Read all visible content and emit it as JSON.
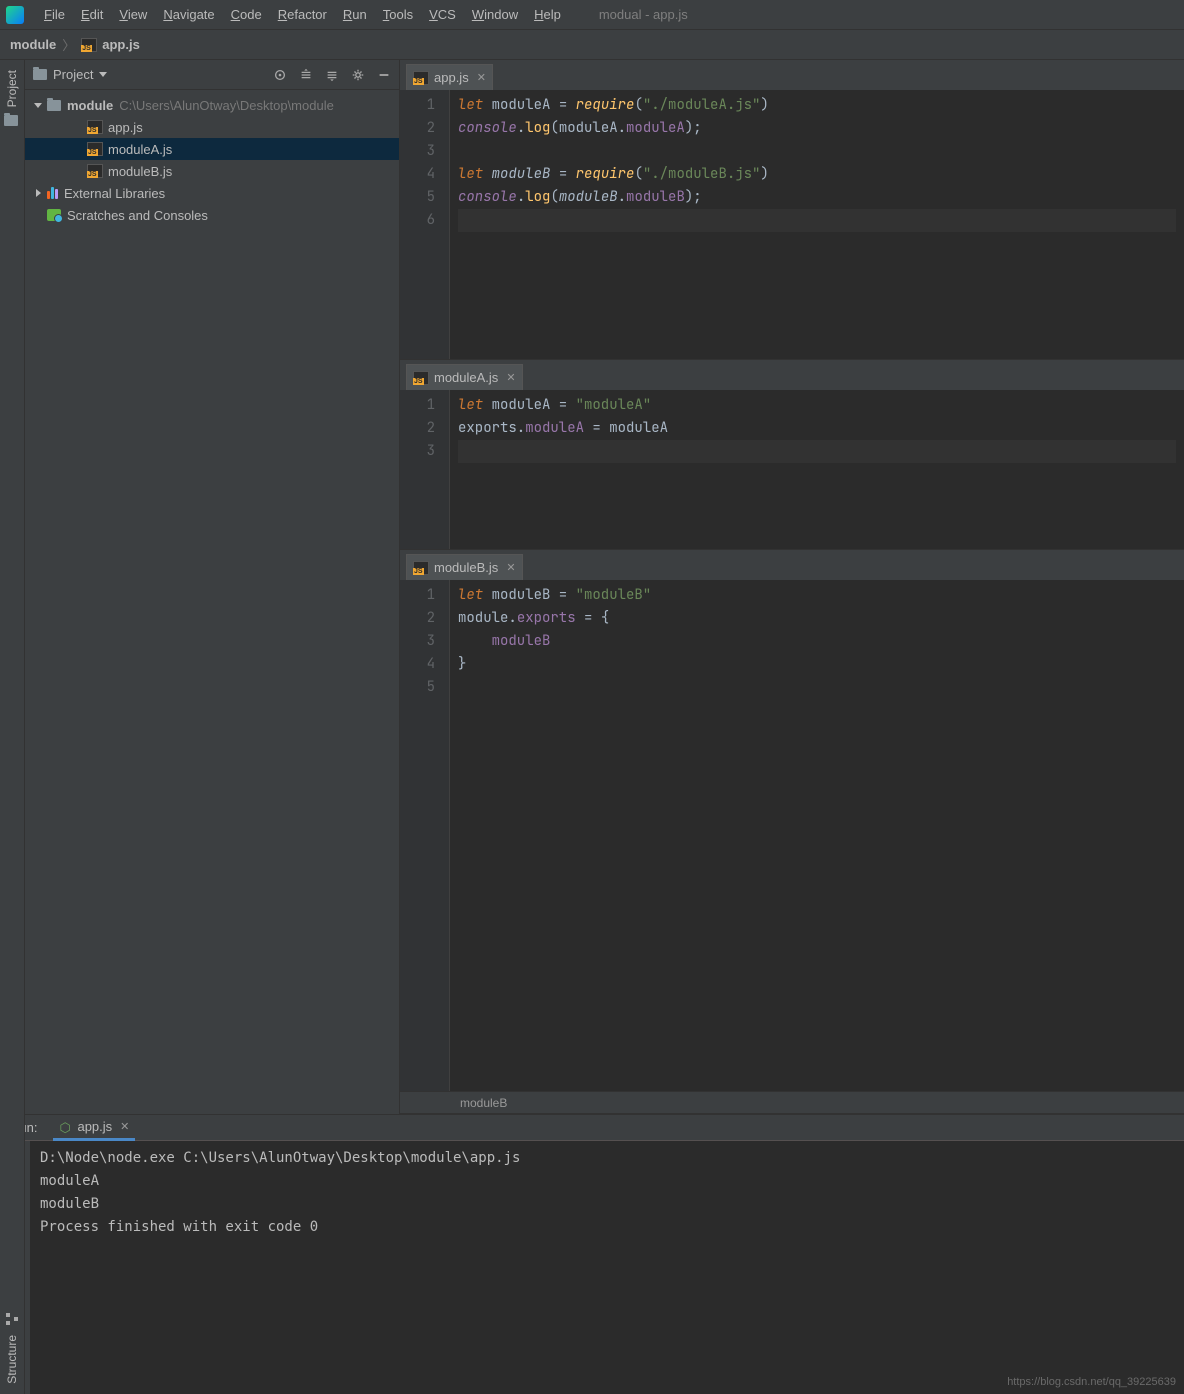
{
  "window_title": "modual - app.js",
  "menu": [
    "File",
    "Edit",
    "View",
    "Navigate",
    "Code",
    "Refactor",
    "Run",
    "Tools",
    "VCS",
    "Window",
    "Help"
  ],
  "breadcrumb": {
    "root": "module",
    "file": "app.js"
  },
  "project_pane": {
    "title": "Project",
    "items": [
      {
        "type": "folder",
        "label": "module",
        "path": "C:\\Users\\AlunOtway\\Desktop\\module",
        "expanded": true,
        "depth": 0,
        "bold": true
      },
      {
        "type": "js",
        "label": "app.js",
        "depth": 2
      },
      {
        "type": "js",
        "label": "moduleA.js",
        "depth": 2,
        "selected": true
      },
      {
        "type": "js",
        "label": "moduleB.js",
        "depth": 2
      },
      {
        "type": "lib",
        "label": "External Libraries",
        "depth": 0,
        "expandable": true
      },
      {
        "type": "scratch",
        "label": "Scratches and Consoles",
        "depth": 0
      }
    ]
  },
  "editors": [
    {
      "tab": "app.js",
      "lines": [
        [
          {
            "t": "let ",
            "c": "kw-i"
          },
          {
            "t": "moduleA ",
            "c": "pl"
          },
          {
            "t": "= ",
            "c": "pl"
          },
          {
            "t": "require",
            "c": "fn"
          },
          {
            "t": "(",
            "c": "pl"
          },
          {
            "t": "\"./moduleA.js\"",
            "c": "str"
          },
          {
            "t": ")",
            "c": "pl"
          }
        ],
        [
          {
            "t": "console",
            "c": "prop-i"
          },
          {
            "t": ".",
            "c": "pl"
          },
          {
            "t": "log",
            "c": "fn2"
          },
          {
            "t": "(moduleA.",
            "c": "pl"
          },
          {
            "t": "moduleA",
            "c": "prop"
          },
          {
            "t": ");",
            "c": "pl"
          }
        ],
        [],
        [
          {
            "t": "let ",
            "c": "kw-i"
          },
          {
            "t": "moduleB",
            "c": "var-i"
          },
          {
            "t": " = ",
            "c": "pl"
          },
          {
            "t": "require",
            "c": "fn"
          },
          {
            "t": "(",
            "c": "pl"
          },
          {
            "t": "\"./moduleB.js\"",
            "c": "str"
          },
          {
            "t": ")",
            "c": "pl"
          }
        ],
        [
          {
            "t": "console",
            "c": "prop-i"
          },
          {
            "t": ".",
            "c": "pl"
          },
          {
            "t": "log",
            "c": "fn2"
          },
          {
            "t": "(",
            "c": "pl"
          },
          {
            "t": "moduleB",
            "c": "var-i"
          },
          {
            "t": ".",
            "c": "pl"
          },
          {
            "t": "moduleB",
            "c": "prop"
          },
          {
            "t": ");",
            "c": "pl"
          }
        ],
        []
      ],
      "cursor_line": 5
    },
    {
      "tab": "moduleA.js",
      "lines": [
        [
          {
            "t": "let ",
            "c": "kw-i"
          },
          {
            "t": "moduleA = ",
            "c": "pl"
          },
          {
            "t": "\"moduleA\"",
            "c": "str"
          }
        ],
        [
          {
            "t": "exports.",
            "c": "pl"
          },
          {
            "t": "moduleA",
            "c": "prop"
          },
          {
            "t": " = moduleA",
            "c": "pl"
          }
        ],
        []
      ],
      "cursor_line": 2
    },
    {
      "tab": "moduleB.js",
      "lines": [
        [
          {
            "t": "let ",
            "c": "kw-i"
          },
          {
            "t": "moduleB = ",
            "c": "pl"
          },
          {
            "t": "\"moduleB\"",
            "c": "str"
          }
        ],
        [
          {
            "t": "module.",
            "c": "pl"
          },
          {
            "t": "exports",
            "c": "prop"
          },
          {
            "t": " = {",
            "c": "pl"
          }
        ],
        [
          {
            "t": "    ",
            "c": "pl"
          },
          {
            "t": "moduleB",
            "c": "prop"
          }
        ],
        [
          {
            "t": "}",
            "c": "pl"
          }
        ],
        []
      ],
      "crumb": "moduleB"
    }
  ],
  "run": {
    "label": "Run:",
    "tab": "app.js",
    "output": [
      "D:\\Node\\node.exe C:\\Users\\AlunOtway\\Desktop\\module\\app.js",
      "moduleA",
      "moduleB",
      "Process finished with exit code 0"
    ]
  },
  "left_tabs": {
    "project": "Project",
    "structure": "Structure"
  },
  "watermark": "https://blog.csdn.net/qq_39225639"
}
